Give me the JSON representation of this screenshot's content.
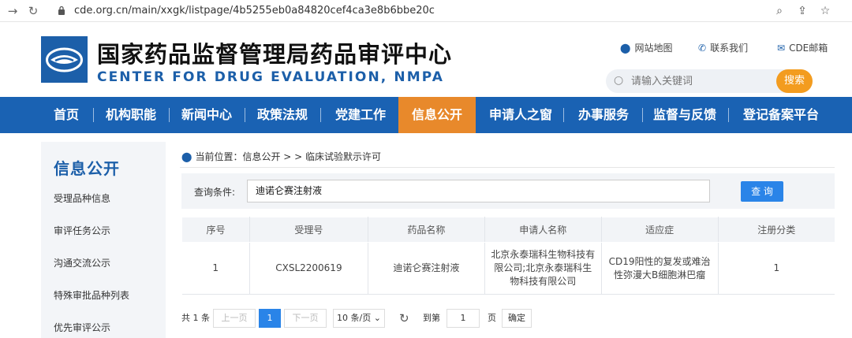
{
  "browser": {
    "back_icon": "arrow-right-icon",
    "reload_icon": "reload-icon",
    "url": "cde.org.cn/main/xxgk/listpage/4b5255eb0a84820cef4ca3e8b6bbe20c"
  },
  "header": {
    "title": "国家药品监督管理局药品审评中心",
    "subtitle": "CENTER FOR DRUG EVALUATION, NMPA",
    "links": {
      "sitemap": "网站地图",
      "contact": "联系我们",
      "mail": "CDE邮箱"
    },
    "search": {
      "placeholder": "请输入关键词",
      "button": "搜索"
    }
  },
  "nav": {
    "items": [
      "首页",
      "机构职能",
      "新闻中心",
      "政策法规",
      "党建工作",
      "信息公开",
      "申请人之窗",
      "办事服务",
      "监督与反馈",
      "登记备案平台"
    ],
    "active": "信息公开"
  },
  "sidebar": {
    "title": "信息公开",
    "items": [
      "受理品种信息",
      "审评任务公示",
      "沟通交流公示",
      "特殊审批品种列表",
      "优先审评公示"
    ]
  },
  "breadcrumb": "当前位置：信息公开 > > 临床试验默示许可",
  "query": {
    "label": "查询条件:",
    "value": "迪诺仑赛注射液",
    "button": "查 询"
  },
  "table": {
    "headers": [
      "序号",
      "受理号",
      "药品名称",
      "申请人名称",
      "适应症",
      "注册分类"
    ],
    "rows": [
      [
        "1",
        "CXSL2200619",
        "迪诺仑赛注射液",
        "北京永泰瑞科生物科技有限公司;北京永泰瑞科生物科技有限公司",
        "CD19阳性的复发或难治性弥漫大B细胞淋巴瘤",
        "1"
      ]
    ]
  },
  "pager": {
    "total": "共 1 条",
    "prev": "上一页",
    "current": "1",
    "next": "下一页",
    "page_size": "10 条/页",
    "goto_label": "到第",
    "goto_value": "1",
    "page_unit": "页",
    "confirm": "确定"
  },
  "colors": {
    "primary": "#1a62b3",
    "accent": "#e8892b",
    "button_blue": "#2a84e8",
    "search_orange": "#f39c1f"
  }
}
